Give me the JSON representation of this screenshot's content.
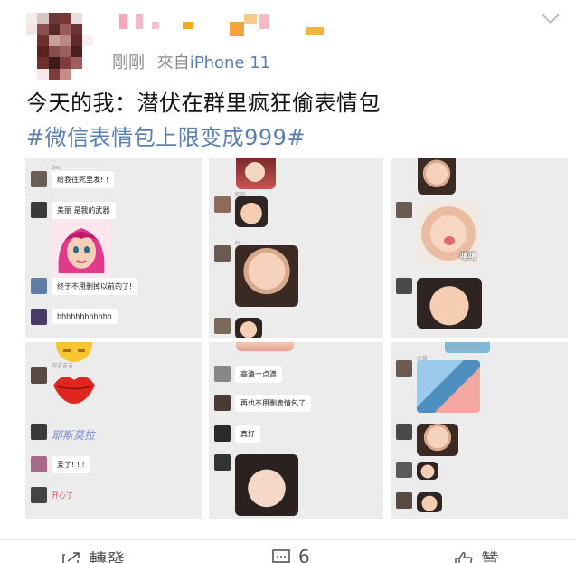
{
  "post": {
    "time": "剛剛",
    "source_prefix": "來自",
    "source_device": "iPhone 11",
    "text": "今天的我：潜伏在群里疯狂偷表情包",
    "hashtag": "#微信表情包上限变成999#"
  },
  "grid": {
    "c1": {
      "msg1_nick": "Bao",
      "msg1": "给我往死里发! !",
      "msg2": "美丽 是我的武器",
      "msg3": "终于不用删掉以前的了!",
      "msg4": "hhhhhhhhhhhh"
    },
    "c2": {
      "nick1": "阿粘",
      "nick2": "阿"
    },
    "c3": {
      "sticker_label": "嘻嘻"
    },
    "c4": {
      "nick1": "阿吉吉吉",
      "hand1": "耶斯莫拉",
      "msg_love": "爱了! ! !",
      "hand2": "开心了"
    },
    "c5": {
      "msg1": "高清一点滴",
      "msg2": "再也不用删表情包了",
      "msg3": "真好"
    },
    "c6": {
      "nick": "大骨"
    }
  },
  "footer": {
    "repost": "轉發",
    "comments": "6",
    "like": "贊"
  },
  "colors": {
    "link": "#5a7fb0",
    "meta": "#8a8a8a",
    "cell_bg": "#ececec"
  }
}
